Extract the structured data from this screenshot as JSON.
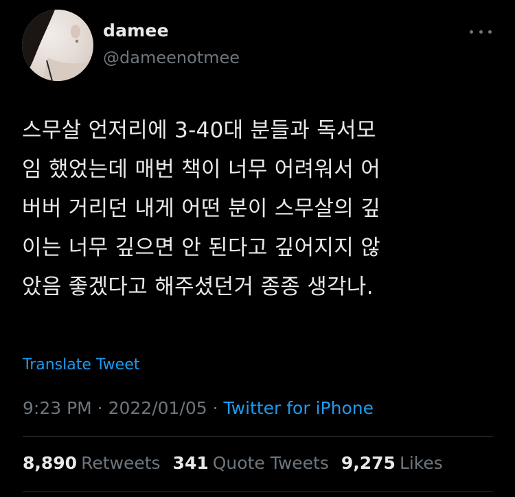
{
  "user": {
    "display_name": "damee",
    "handle": "@dameenotmee",
    "avatar_icon": "profile-photo"
  },
  "tweet": {
    "text_lines": [
      "스무살 언저리에 3-40대 분들과 독서모",
      "임 했었는데 매번 책이 너무 어려워서 어",
      "버버 거리던 내게 어떤 분이 스무살의 깊",
      "이는 너무 깊으면 안 된다고 깊어지지 않",
      "았음 좋겠다고 해주셨던거 종종 생각나."
    ],
    "translate_label": "Translate Tweet"
  },
  "meta": {
    "time": "9:23 PM",
    "separator": " · ",
    "date": "2022/01/05",
    "source": "Twitter for iPhone"
  },
  "stats": {
    "retweets_count": "8,890",
    "retweets_label": "Retweets",
    "quotes_count": "341",
    "quotes_label": "Quote Tweets",
    "likes_count": "9,275",
    "likes_label": "Likes"
  },
  "colors": {
    "background": "#000000",
    "text": "#e7e9ea",
    "secondary": "#6e767d",
    "link": "#1d9bf0"
  }
}
